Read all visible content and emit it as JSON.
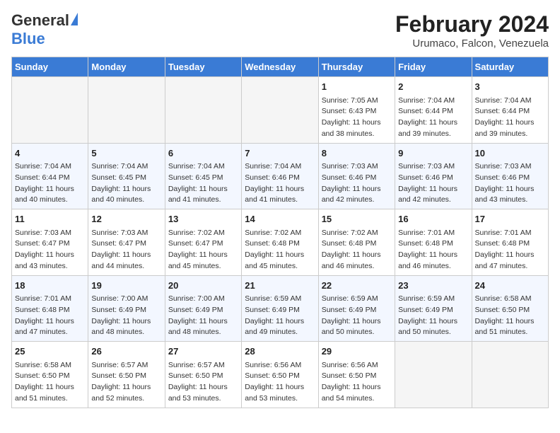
{
  "header": {
    "logo_general": "General",
    "logo_blue": "Blue",
    "title": "February 2024",
    "subtitle": "Urumaco, Falcon, Venezuela"
  },
  "days_of_week": [
    "Sunday",
    "Monday",
    "Tuesday",
    "Wednesday",
    "Thursday",
    "Friday",
    "Saturday"
  ],
  "weeks": [
    [
      {
        "day": "",
        "empty": true
      },
      {
        "day": "",
        "empty": true
      },
      {
        "day": "",
        "empty": true
      },
      {
        "day": "",
        "empty": true
      },
      {
        "day": "1",
        "sunrise": "Sunrise: 7:05 AM",
        "sunset": "Sunset: 6:43 PM",
        "daylight": "Daylight: 11 hours and 38 minutes."
      },
      {
        "day": "2",
        "sunrise": "Sunrise: 7:04 AM",
        "sunset": "Sunset: 6:44 PM",
        "daylight": "Daylight: 11 hours and 39 minutes."
      },
      {
        "day": "3",
        "sunrise": "Sunrise: 7:04 AM",
        "sunset": "Sunset: 6:44 PM",
        "daylight": "Daylight: 11 hours and 39 minutes."
      }
    ],
    [
      {
        "day": "4",
        "sunrise": "Sunrise: 7:04 AM",
        "sunset": "Sunset: 6:44 PM",
        "daylight": "Daylight: 11 hours and 40 minutes."
      },
      {
        "day": "5",
        "sunrise": "Sunrise: 7:04 AM",
        "sunset": "Sunset: 6:45 PM",
        "daylight": "Daylight: 11 hours and 40 minutes."
      },
      {
        "day": "6",
        "sunrise": "Sunrise: 7:04 AM",
        "sunset": "Sunset: 6:45 PM",
        "daylight": "Daylight: 11 hours and 41 minutes."
      },
      {
        "day": "7",
        "sunrise": "Sunrise: 7:04 AM",
        "sunset": "Sunset: 6:46 PM",
        "daylight": "Daylight: 11 hours and 41 minutes."
      },
      {
        "day": "8",
        "sunrise": "Sunrise: 7:03 AM",
        "sunset": "Sunset: 6:46 PM",
        "daylight": "Daylight: 11 hours and 42 minutes."
      },
      {
        "day": "9",
        "sunrise": "Sunrise: 7:03 AM",
        "sunset": "Sunset: 6:46 PM",
        "daylight": "Daylight: 11 hours and 42 minutes."
      },
      {
        "day": "10",
        "sunrise": "Sunrise: 7:03 AM",
        "sunset": "Sunset: 6:46 PM",
        "daylight": "Daylight: 11 hours and 43 minutes."
      }
    ],
    [
      {
        "day": "11",
        "sunrise": "Sunrise: 7:03 AM",
        "sunset": "Sunset: 6:47 PM",
        "daylight": "Daylight: 11 hours and 43 minutes."
      },
      {
        "day": "12",
        "sunrise": "Sunrise: 7:03 AM",
        "sunset": "Sunset: 6:47 PM",
        "daylight": "Daylight: 11 hours and 44 minutes."
      },
      {
        "day": "13",
        "sunrise": "Sunrise: 7:02 AM",
        "sunset": "Sunset: 6:47 PM",
        "daylight": "Daylight: 11 hours and 45 minutes."
      },
      {
        "day": "14",
        "sunrise": "Sunrise: 7:02 AM",
        "sunset": "Sunset: 6:48 PM",
        "daylight": "Daylight: 11 hours and 45 minutes."
      },
      {
        "day": "15",
        "sunrise": "Sunrise: 7:02 AM",
        "sunset": "Sunset: 6:48 PM",
        "daylight": "Daylight: 11 hours and 46 minutes."
      },
      {
        "day": "16",
        "sunrise": "Sunrise: 7:01 AM",
        "sunset": "Sunset: 6:48 PM",
        "daylight": "Daylight: 11 hours and 46 minutes."
      },
      {
        "day": "17",
        "sunrise": "Sunrise: 7:01 AM",
        "sunset": "Sunset: 6:48 PM",
        "daylight": "Daylight: 11 hours and 47 minutes."
      }
    ],
    [
      {
        "day": "18",
        "sunrise": "Sunrise: 7:01 AM",
        "sunset": "Sunset: 6:48 PM",
        "daylight": "Daylight: 11 hours and 47 minutes."
      },
      {
        "day": "19",
        "sunrise": "Sunrise: 7:00 AM",
        "sunset": "Sunset: 6:49 PM",
        "daylight": "Daylight: 11 hours and 48 minutes."
      },
      {
        "day": "20",
        "sunrise": "Sunrise: 7:00 AM",
        "sunset": "Sunset: 6:49 PM",
        "daylight": "Daylight: 11 hours and 48 minutes."
      },
      {
        "day": "21",
        "sunrise": "Sunrise: 6:59 AM",
        "sunset": "Sunset: 6:49 PM",
        "daylight": "Daylight: 11 hours and 49 minutes."
      },
      {
        "day": "22",
        "sunrise": "Sunrise: 6:59 AM",
        "sunset": "Sunset: 6:49 PM",
        "daylight": "Daylight: 11 hours and 50 minutes."
      },
      {
        "day": "23",
        "sunrise": "Sunrise: 6:59 AM",
        "sunset": "Sunset: 6:49 PM",
        "daylight": "Daylight: 11 hours and 50 minutes."
      },
      {
        "day": "24",
        "sunrise": "Sunrise: 6:58 AM",
        "sunset": "Sunset: 6:50 PM",
        "daylight": "Daylight: 11 hours and 51 minutes."
      }
    ],
    [
      {
        "day": "25",
        "sunrise": "Sunrise: 6:58 AM",
        "sunset": "Sunset: 6:50 PM",
        "daylight": "Daylight: 11 hours and 51 minutes."
      },
      {
        "day": "26",
        "sunrise": "Sunrise: 6:57 AM",
        "sunset": "Sunset: 6:50 PM",
        "daylight": "Daylight: 11 hours and 52 minutes."
      },
      {
        "day": "27",
        "sunrise": "Sunrise: 6:57 AM",
        "sunset": "Sunset: 6:50 PM",
        "daylight": "Daylight: 11 hours and 53 minutes."
      },
      {
        "day": "28",
        "sunrise": "Sunrise: 6:56 AM",
        "sunset": "Sunset: 6:50 PM",
        "daylight": "Daylight: 11 hours and 53 minutes."
      },
      {
        "day": "29",
        "sunrise": "Sunrise: 6:56 AM",
        "sunset": "Sunset: 6:50 PM",
        "daylight": "Daylight: 11 hours and 54 minutes."
      },
      {
        "day": "",
        "empty": true
      },
      {
        "day": "",
        "empty": true
      }
    ]
  ]
}
